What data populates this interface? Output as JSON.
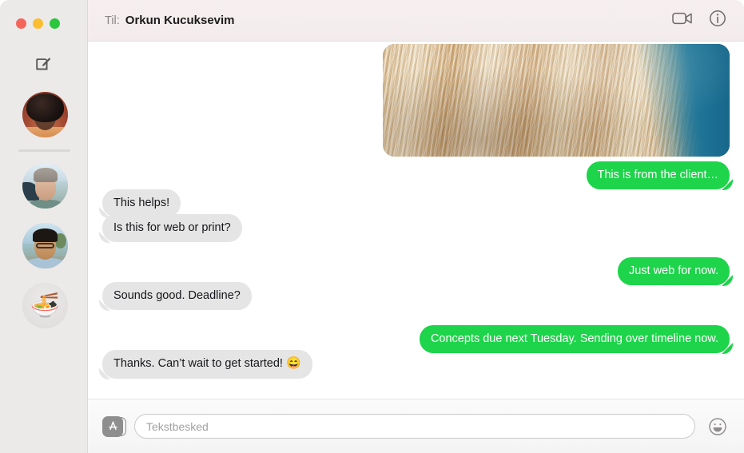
{
  "window": {
    "traffic_lights": [
      {
        "name": "close",
        "color": "#f5665a"
      },
      {
        "name": "minimize",
        "color": "#fbbe2f"
      },
      {
        "name": "zoom",
        "color": "#2ac63c"
      }
    ]
  },
  "sidebar": {
    "compose_icon": "compose-icon",
    "conversations": [
      {
        "name": "conversation-avatar-1",
        "kind": "photo-person-afro"
      },
      {
        "name": "conversation-avatar-2",
        "kind": "photo-person-beanie"
      },
      {
        "name": "conversation-avatar-3",
        "kind": "photo-person-glasses"
      },
      {
        "name": "conversation-avatar-4",
        "kind": "emoji-noodle-bowl",
        "emoji": "🍜"
      }
    ]
  },
  "header": {
    "to_label": "Til:",
    "recipient": "Orkun Kucuksevim",
    "actions": [
      {
        "name": "facetime-video-icon",
        "label": "FaceTime"
      },
      {
        "name": "details-info-icon",
        "label": "Detaljer"
      }
    ]
  },
  "transcript": {
    "attachment": {
      "name": "photo-attachment",
      "description": "Naerbillede af blondt haar mod blaa baggrund"
    },
    "messages": [
      {
        "id": "m1",
        "side": "sent",
        "text": "This is from the client…"
      },
      {
        "id": "m2",
        "side": "received",
        "text": "This helps!"
      },
      {
        "id": "m3",
        "side": "received",
        "text": "Is this for web or print?"
      },
      {
        "id": "m4",
        "side": "sent",
        "text": "Just web for now."
      },
      {
        "id": "m5",
        "side": "received",
        "text": "Sounds good. Deadline?"
      },
      {
        "id": "m6",
        "side": "sent",
        "text": "Concepts due next Tuesday. Sending over timeline now."
      },
      {
        "id": "m7",
        "side": "received",
        "text": "Thanks. Can’t wait to get started! ",
        "emoji": "😄"
      }
    ]
  },
  "compose": {
    "apps_button_label": "App Store",
    "input_value": "",
    "input_placeholder": "Tekstbesked",
    "emoji_button_label": "Emoji"
  },
  "colors": {
    "sent_bubble": "#1ed44a",
    "received_bubble": "#e6e5e5",
    "sidebar_bg": "#ece9e9",
    "titlebar_bg": "#f4eded"
  }
}
